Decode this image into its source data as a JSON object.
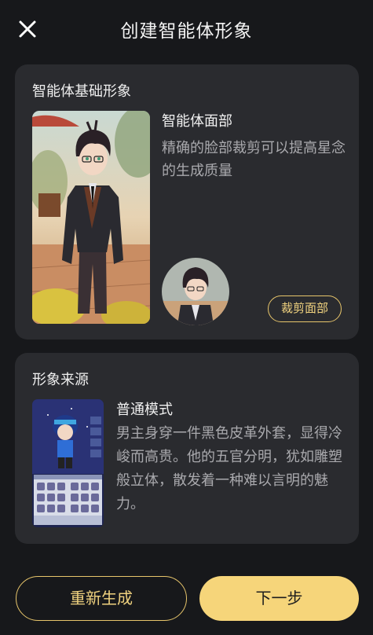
{
  "header": {
    "title": "创建智能体形象",
    "close_icon": "close-icon"
  },
  "base_card": {
    "label": "智能体基础形象",
    "portrait_image": "anime-character-portrait",
    "face_title": "智能体面部",
    "face_desc": "精确的脸部裁剪可以提高星念的生成质量",
    "avatar_image": "cropped-face-avatar",
    "crop_button": "裁剪面部"
  },
  "source_card": {
    "label": "形象来源",
    "thumbnail_image": "game-character-editor-screenshot",
    "mode_title": "普通模式",
    "mode_desc": "男主身穿一件黑色皮革外套，显得冷峻而高贵。他的五官分明，犹如雕塑般立体，散发着一种难以言明的魅力。"
  },
  "actions": {
    "regenerate": "重新生成",
    "next": "下一步"
  },
  "colors": {
    "background": "#17181b",
    "card": "#2a2b2f",
    "accent": "#f6d57a",
    "accent_outline": "#e7c56b",
    "secondary_text": "#a9a9ad"
  }
}
